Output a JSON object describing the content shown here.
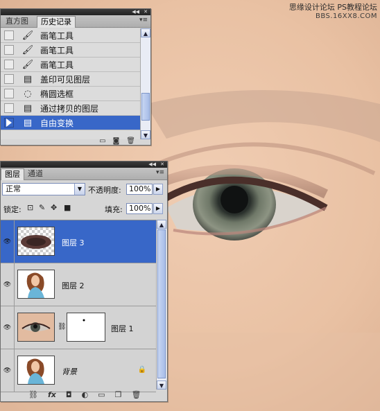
{
  "watermark": {
    "line1": "思缘设计论坛",
    "line2": "BBS.16XX8.COM",
    "corner_text": "PS教程论坛"
  },
  "history_panel": {
    "tabs": [
      "直方图",
      "历史记录"
    ],
    "active_tab": 1,
    "items": [
      {
        "label": "画笔工具",
        "icon": "brush-icon",
        "selected": false
      },
      {
        "label": "画笔工具",
        "icon": "brush-icon",
        "selected": false
      },
      {
        "label": "画笔工具",
        "icon": "brush-icon",
        "selected": false
      },
      {
        "label": "盖印可见图层",
        "icon": "document-icon",
        "selected": false
      },
      {
        "label": "椭圆选框",
        "icon": "ellipse-marquee-icon",
        "selected": false
      },
      {
        "label": "通过拷贝的图层",
        "icon": "document-icon",
        "selected": false
      },
      {
        "label": "自由变换",
        "icon": "document-icon",
        "selected": true
      }
    ],
    "scroll_position": 0.85
  },
  "layers_panel": {
    "tabs": [
      "图层",
      "通道"
    ],
    "active_tab": 0,
    "blend_mode": "正常",
    "opacity_label": "不透明度:",
    "opacity_value": "100%",
    "lock_label": "锁定:",
    "fill_label": "填充:",
    "fill_value": "100%",
    "layers": [
      {
        "name": "图层 3",
        "thumb": "eye-crop",
        "selected": true,
        "has_mask": false,
        "locked": false
      },
      {
        "name": "图层 2",
        "thumb": "woman",
        "selected": false,
        "has_mask": false,
        "locked": false
      },
      {
        "name": "图层 1",
        "thumb": "eye",
        "selected": false,
        "has_mask": true,
        "locked": false
      },
      {
        "name": "背景",
        "thumb": "woman",
        "selected": false,
        "has_mask": false,
        "locked": true,
        "italic": true
      }
    ],
    "footer_icons": [
      "link-icon",
      "fx-icon",
      "mask-icon",
      "adjustment-icon",
      "group-folder-icon",
      "new-layer-icon",
      "trash-icon"
    ]
  },
  "colors": {
    "selection": "#3867c8",
    "panel_bg": "#d6d6d6",
    "skin": "#e8c2a6"
  }
}
